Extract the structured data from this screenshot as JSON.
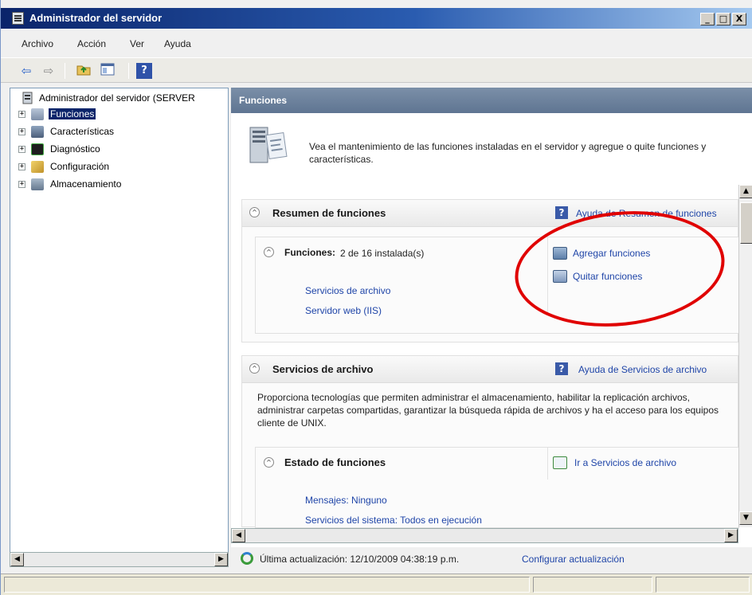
{
  "window": {
    "title": "Administrador del servidor",
    "controls": {
      "minimize": "_",
      "maximize": "□",
      "close": "X"
    }
  },
  "menu": [
    "Archivo",
    "Acción",
    "Ver",
    "Ayuda"
  ],
  "toolbar": {
    "icons": [
      "back-arrow-icon",
      "forward-arrow-icon",
      "up-folder-icon",
      "show-hide-tree-icon",
      "help-icon"
    ],
    "help_glyph": "?"
  },
  "tree": {
    "root": "Administrador del servidor (SERVER",
    "items": [
      {
        "label": "Funciones",
        "selected": true,
        "icon": "roles-icon"
      },
      {
        "label": "Características",
        "icon": "features-icon"
      },
      {
        "label": "Diagnóstico",
        "icon": "diagnostics-icon"
      },
      {
        "label": "Configuración",
        "icon": "configuration-icon"
      },
      {
        "label": "Almacenamiento",
        "icon": "storage-icon"
      }
    ],
    "expander_glyph": "+"
  },
  "main": {
    "header": "Funciones",
    "intro": "Vea el mantenimiento de las funciones instaladas en el servidor y agregue o quite funciones y características.",
    "summary": {
      "title": "Resumen de funciones",
      "help_link": "Ayuda de Resumen de funciones",
      "roles_label": "Funciones:",
      "roles_count": "2 de 16 instalada(s)",
      "roles": [
        "Servicios de archivo",
        "Servidor web (IIS)"
      ],
      "actions": [
        "Agregar funciones",
        "Quitar funciones"
      ]
    },
    "file_services": {
      "title": "Servicios de archivo",
      "help_link": "Ayuda de Servicios de archivo",
      "description": "Proporciona tecnologías que permiten administrar el almacenamiento, habilitar la replicación archivos, administrar carpetas compartidas, garantizar la búsqueda rápida de archivos y ha el acceso para los equipos cliente de UNIX.",
      "status_title": "Estado de funciones",
      "goto_link": "Ir a Servicios de archivo",
      "messages": "Mensajes: Ninguno",
      "system_services": "Servicios del sistema: Todos en ejecución"
    },
    "chevron_glyph": "^"
  },
  "status": {
    "last_update": "Última actualización: 12/10/2009 04:38:19 p.m.",
    "configure_link": "Configurar actualización"
  },
  "colors": {
    "title_gradient_start": "#0a246a",
    "link": "#1f45a8",
    "selection": "#0a246a",
    "annotation_ellipse": "#e00000"
  }
}
